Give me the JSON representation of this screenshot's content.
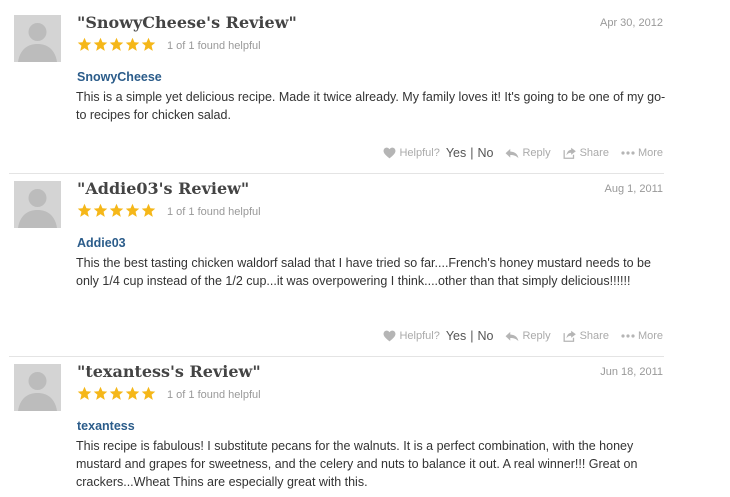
{
  "reviews": [
    {
      "title": "\"SnowyCheese's Review\"",
      "date": "Apr 30, 2012",
      "rating": 5,
      "helpful_count": "1 of 1 found helpful",
      "author": "SnowyCheese",
      "body": "This is a simple yet delicious recipe. Made it twice already. My family loves it! It's going to be one of my go-to recipes for chicken salad."
    },
    {
      "title": "\"Addie03's Review\"",
      "date": "Aug 1, 2011",
      "rating": 5,
      "helpful_count": "1 of 1 found helpful",
      "author": "Addie03",
      "body": "This the best tasting chicken waldorf salad that I have tried so far....French's honey mustard needs to be only 1/4 cup instead of the 1/2 cup...it was overpowering I think....other than that simply delicious!!!!!!"
    },
    {
      "title": "\"texantess's Review\"",
      "date": "Jun 18, 2011",
      "rating": 5,
      "helpful_count": "1 of 1 found helpful",
      "author": "texantess",
      "body": "This recipe is fabulous! I substitute pecans for the walnuts. It is a perfect combination, with the honey mustard and grapes for sweetness, and the celery and nuts to balance it out. A real winner!!! Great on crackers...Wheat Thins are especially great with this."
    }
  ],
  "actions": {
    "helpful_label": "Helpful?",
    "yes_label": "Yes",
    "separator": "|",
    "no_label": "No",
    "reply_label": "Reply",
    "share_label": "Share",
    "more_label": "More"
  },
  "colors": {
    "star": "#f5b719",
    "author_link": "#2b5c8a",
    "title": "#444444",
    "muted": "#999999"
  },
  "icons": {
    "avatar": "default-user-silhouette-icon",
    "star": "star-icon",
    "helpful": "heart-icon",
    "reply": "reply-arrow-icon",
    "share": "share-icon",
    "more": "ellipsis-icon"
  }
}
